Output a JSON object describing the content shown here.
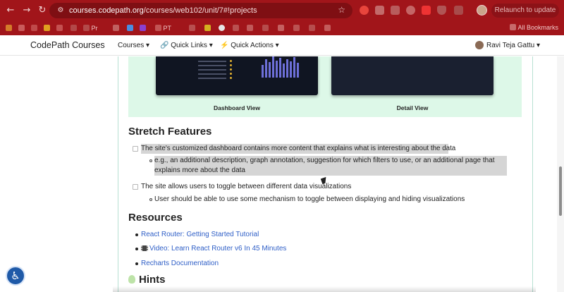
{
  "browser": {
    "url_host": "courses.codepath.org",
    "url_path": "/courses/web102/unit/7#!projects",
    "relaunch_label": "Relaunch to update",
    "bookmarks": [
      "Pr",
      "PT"
    ],
    "all_bookmarks_label": "All Bookmarks"
  },
  "header": {
    "brand": "CodePath Courses",
    "nav": [
      {
        "label": "Courses",
        "icon": "caret-down"
      },
      {
        "label": "Quick Links",
        "icon": "link-icon"
      },
      {
        "label": "Quick Actions",
        "icon": "bolt-icon"
      }
    ],
    "user_name": "Ravi Teja Gattu"
  },
  "gallery": {
    "captions": [
      "Dashboard View",
      "Detail View"
    ]
  },
  "stretch": {
    "title": "Stretch Features",
    "items": [
      {
        "text": "The site's customized dashboard contains more content that explains what is interesting about the data",
        "sub": "e.g., an additional description, graph annotation, suggestion for which filters to use, or an additional page that explains more about the data"
      },
      {
        "text": "The site allows users to toggle between different data visualizations",
        "sub": "User should be able to use some mechanism to toggle between displaying and hiding visualizations"
      }
    ]
  },
  "resources": {
    "title": "Resources",
    "links": [
      "React Router: Getting Started Tutorial",
      "Video: Learn React Router v6 In 45 Minutes",
      "Recharts Documentation"
    ]
  },
  "hints": {
    "title": "Hints"
  },
  "colors": {
    "chrome": "#a1151a",
    "link": "#2f5fc7",
    "gallery_bg": "#ddf8e8"
  }
}
